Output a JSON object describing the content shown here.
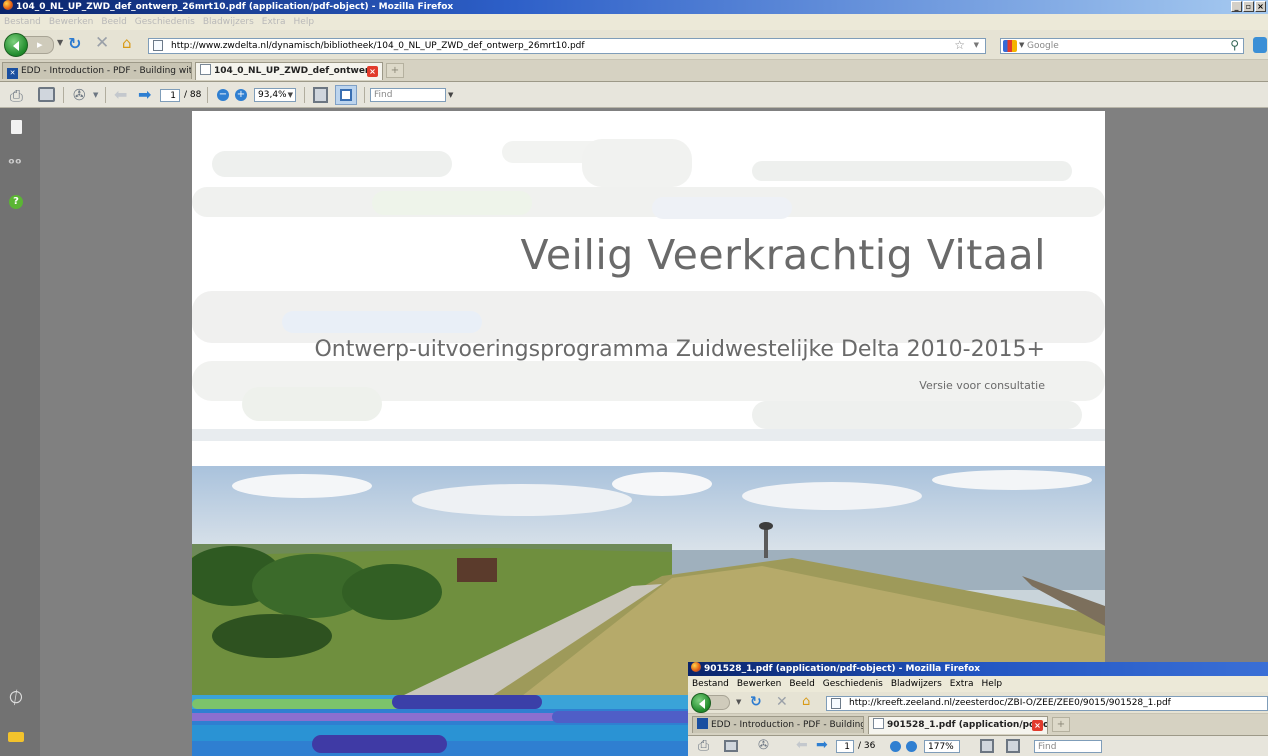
{
  "window": {
    "title": "104_0_NL_UP_ZWD_def_ontwerp_26mrt10.pdf (application/pdf-object) - Mozilla Firefox",
    "controls": [
      "_",
      "̵",
      "x"
    ]
  },
  "menu": [
    "Bestand",
    "Bewerken",
    "Beeld",
    "Geschiedenis",
    "Bladwijzers",
    "Extra",
    "Help"
  ],
  "nav": {
    "url": "http://www.zwdelta.nl/dynamisch/bibliotheek/104_0_NL_UP_ZWD_def_ontwerp_26mrt10.pdf",
    "search_placeholder": "Google"
  },
  "tabs": [
    {
      "label": "EDD - Introduction - PDF - Building with...",
      "active": false
    },
    {
      "label": "104_0_NL_UP_ZWD_def_ontwer...",
      "active": true
    }
  ],
  "pdf_toolbar": {
    "page_current": "1",
    "page_total": "/ 88",
    "zoom": "93,4%",
    "find_placeholder": "Find"
  },
  "document": {
    "title": "Veilig Veerkrachtig Vitaal",
    "subtitle": "Ontwerp-uitvoeringsprogramma Zuidwestelijke Delta 2010-2015+",
    "note": "Versie voor consultatie"
  },
  "window2": {
    "title": "901528_1.pdf (application/pdf-object) - Mozilla Firefox",
    "menu": [
      "Bestand",
      "Bewerken",
      "Beeld",
      "Geschiedenis",
      "Bladwijzers",
      "Extra",
      "Help"
    ],
    "url": "http://kreeft.zeeland.nl/zeesterdoc/ZBI-O/ZEE/ZEE0/9015/901528_1.pdf",
    "tabs": [
      {
        "label": "EDD - Introduction - PDF - Building with...",
        "active": false
      },
      {
        "label": "901528_1.pdf (application/pdf-o...",
        "active": true
      }
    ],
    "page_current": "1",
    "page_total": "/ 36",
    "zoom": "177%",
    "find_placeholder": "Find"
  },
  "colors": {
    "titlebar_start": "#0a246a",
    "titlebar_end": "#a6caf0",
    "viewer_bg": "#808080",
    "sidebar_bg": "#727272",
    "doc_text": "#6a6a6a",
    "stripe_blue": "#2f7fd1"
  },
  "icons": [
    "firefox-icon",
    "back-arrow-icon",
    "forward-arrow-icon",
    "reload-icon",
    "stop-icon",
    "home-icon",
    "page-icon",
    "star-icon",
    "google-icon",
    "search-icon",
    "print-icon",
    "save-icon",
    "tools-icon",
    "prev-page-icon",
    "next-page-icon",
    "zoom-out-icon",
    "zoom-in-icon",
    "fit-width-icon",
    "fit-page-icon",
    "pages-panel-icon",
    "binoculars-icon",
    "help-icon",
    "attachment-icon",
    "comments-icon"
  ]
}
